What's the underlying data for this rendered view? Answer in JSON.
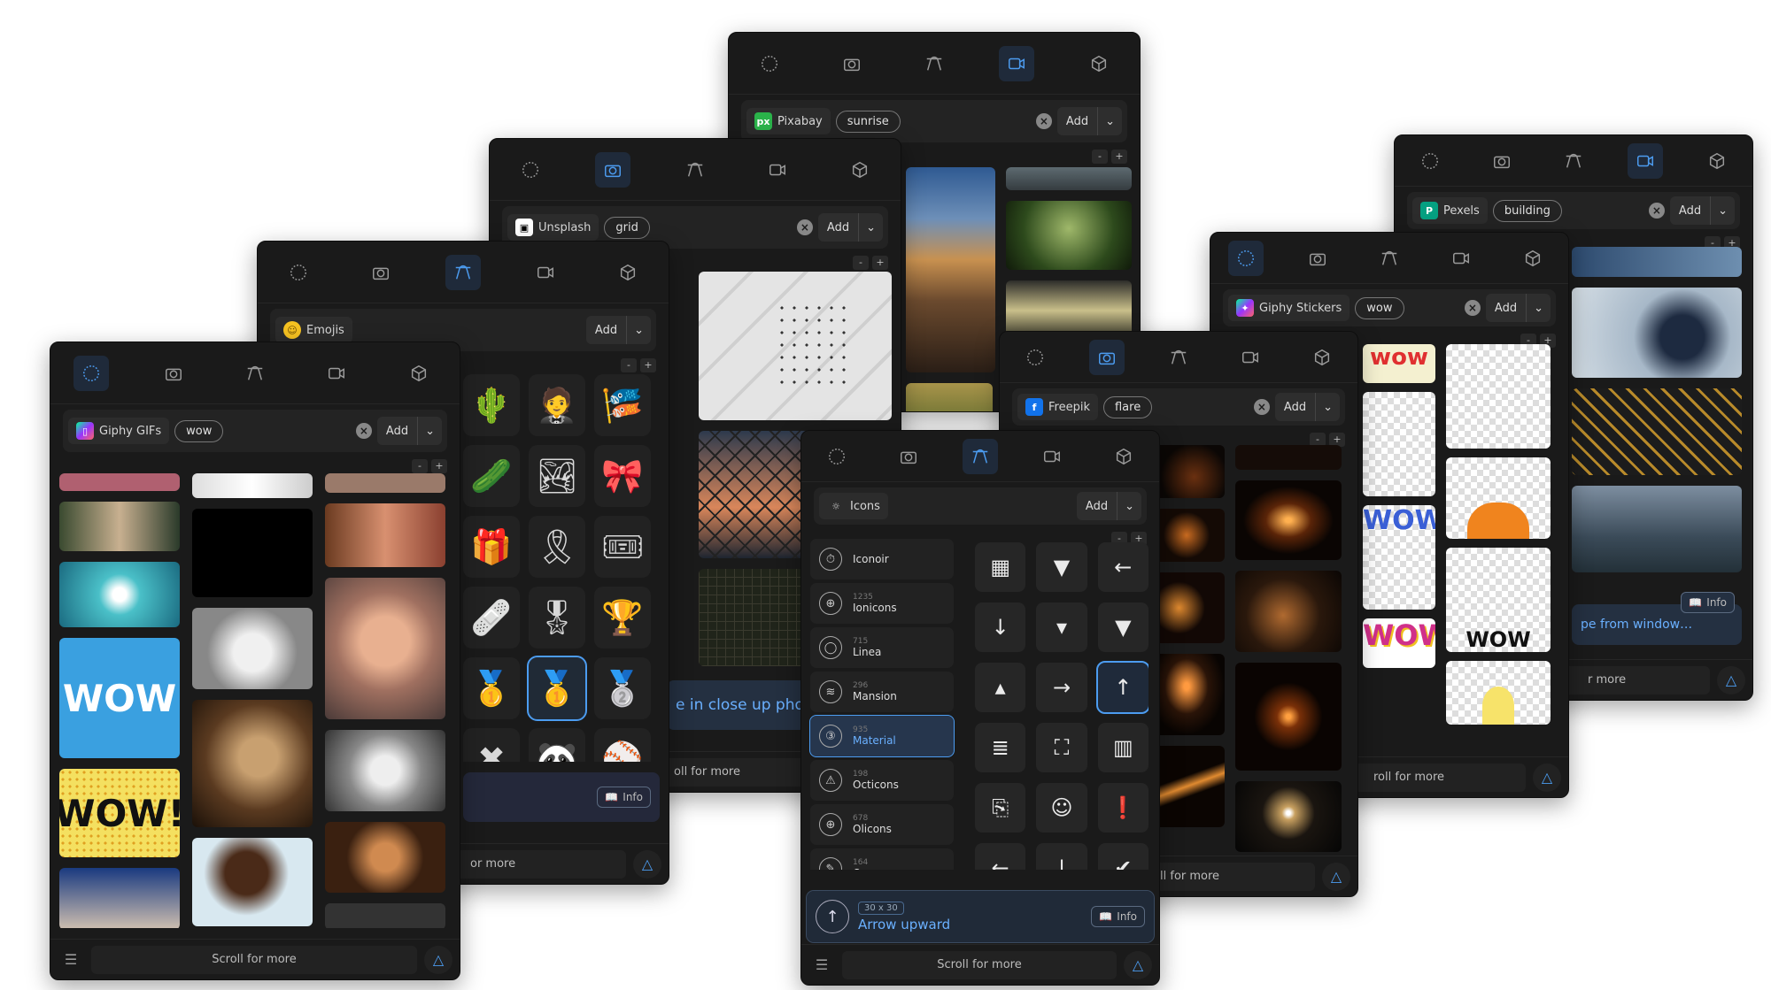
{
  "panels": {
    "pixabay": {
      "source": "Pixabay",
      "query": "sunrise",
      "add": "Add"
    },
    "pexels": {
      "source": "Pexels",
      "query": "building",
      "add": "Add",
      "info": "Info",
      "preview_text": "pe from window…",
      "footer": "r more"
    },
    "unsplash": {
      "source": "Unsplash",
      "query": "grid",
      "add": "Add",
      "preview_text": "e in close up phot",
      "footer": "oll for more"
    },
    "stickers": {
      "source": "Giphy Stickers",
      "query": "wow",
      "add": "Add",
      "footer": "roll for more"
    },
    "emojis": {
      "source": "Emojis",
      "add": "Add",
      "info": "Info",
      "footer": "or more"
    },
    "freepik": {
      "source": "Freepik",
      "query": "flare",
      "add": "Add",
      "footer": "roll for more"
    },
    "gifs": {
      "source": "Giphy GIFs",
      "query": "wow",
      "add": "Add",
      "footer": "Scroll for more"
    },
    "icons": {
      "source": "Icons",
      "add": "Add",
      "sets": [
        {
          "count": "",
          "name": "Iconoir"
        },
        {
          "count": "1235",
          "name": "Ionicons"
        },
        {
          "count": "715",
          "name": "Linea"
        },
        {
          "count": "296",
          "name": "Mansion"
        },
        {
          "count": "935",
          "name": "Material"
        },
        {
          "count": "198",
          "name": "Octicons"
        },
        {
          "count": "678",
          "name": "Olicons"
        },
        {
          "count": "164",
          "name": "Openpeeps"
        }
      ],
      "selected_size": "30 x 30",
      "selected_name": "Arrow upward",
      "info": "Info",
      "footer": "Scroll for more"
    }
  },
  "emoji_glyphs": [
    "🌵",
    "🤵",
    "🎏",
    "🥒",
    "🏞",
    "🎀",
    "🎁",
    "🎗",
    "🎟",
    "🩹",
    "🎖",
    "🏆",
    "🥇",
    "🥇",
    "🥈",
    "✖",
    "🐼",
    "⚾"
  ],
  "icon_glyphs": [
    "▦",
    "▼",
    "←",
    "↓",
    "▾",
    "▼",
    "▴",
    "→",
    "↑",
    "≣",
    "⛶",
    "▥",
    "⎘",
    "☺",
    "❗",
    "←",
    "↓",
    "✔"
  ],
  "sticker_words": [
    "wow",
    "WOW",
    "WOW",
    "WOW"
  ],
  "gif_words": [
    "WOW",
    "WOW!"
  ],
  "accent": "#4c9cf0"
}
